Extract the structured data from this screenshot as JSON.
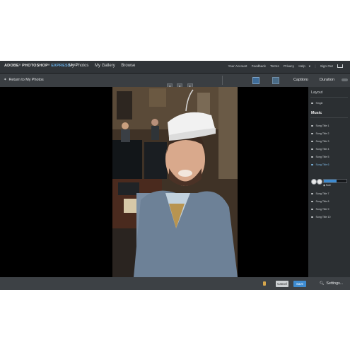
{
  "header": {
    "brand_adobe": "ADOBE",
    "brand_ps": "PHOTOSHOP",
    "brand_express": "EXPRESS",
    "brand_beta": "BETA",
    "nav": [
      "My Photos",
      "My Gallery",
      "Browse"
    ],
    "right_links": [
      "Your Account",
      "Feedback",
      "Terms",
      "Privacy",
      "Help",
      "Sign Out"
    ]
  },
  "toolbar": {
    "back_label": "Return to My Photos",
    "prev_icon": "◂",
    "play_icon": "▸",
    "next_icon": "▸",
    "captions_label": "Captions"
  },
  "panel": {
    "duration_label": "Duration",
    "layout_title": "Layout",
    "layout_option": "Single",
    "music_title": "Music",
    "songs": [
      "Song Title 1",
      "Song Title 2",
      "Song Title 3",
      "Song Title 4",
      "Song Title 5",
      "Song Title 6",
      "Song Title 7",
      "Song Title 8",
      "Song Title 9",
      "Song Title 10"
    ],
    "selected_song_index": 5,
    "volume_label": "Note",
    "progress": 0.55
  },
  "footer": {
    "cancel_label": "Cancel",
    "save_label": "Save",
    "settings_label": "Settings..."
  },
  "colors": {
    "accent": "#3e8bd0",
    "app_bg": "#1f2224",
    "toolbar_bg": "#3a3e42"
  }
}
